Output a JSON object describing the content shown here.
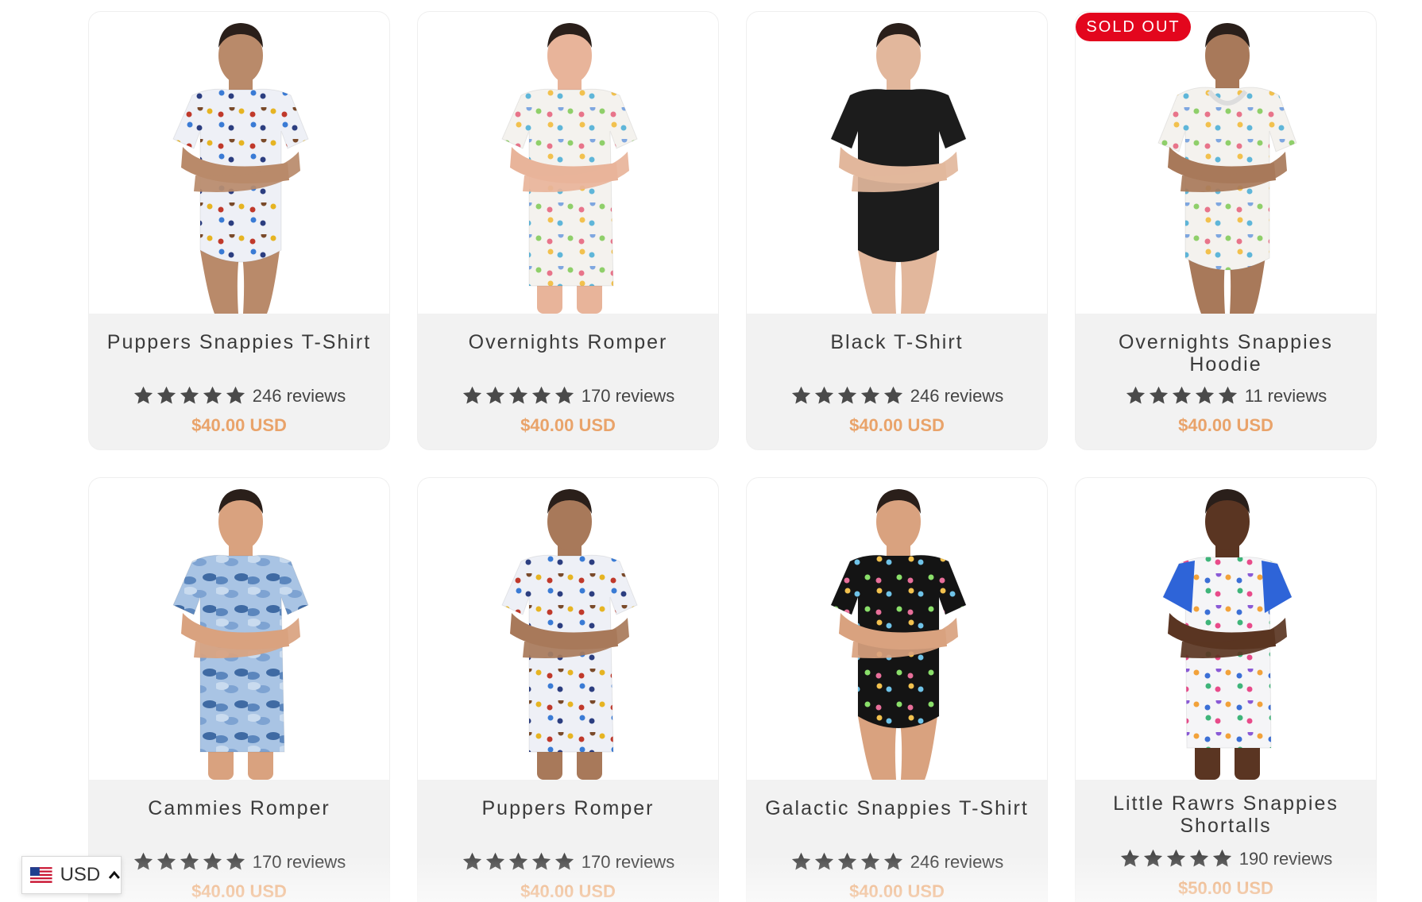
{
  "badge": {
    "sold_out": "SOLD OUT"
  },
  "currency_selector": {
    "code": "USD",
    "flag": "us-flag-icon"
  },
  "colors": {
    "price": "#e9a36a",
    "badge": "#e3061d",
    "card_bg": "#f2f2f2",
    "star": "#4a4a4a"
  },
  "products": [
    {
      "title": "Puppers Snappies T-Shirt",
      "rating_stars": 5,
      "reviews": "246 reviews",
      "price": "$40.00 USD",
      "garment": "tee",
      "pattern": "puppers",
      "skin": "#b98a6a"
    },
    {
      "title": "Overnights Romper",
      "rating_stars": 5,
      "reviews": "170 reviews",
      "price": "$40.00 USD",
      "garment": "romper",
      "pattern": "overnights",
      "skin": "#e8b49a"
    },
    {
      "title": "Black T-Shirt",
      "rating_stars": 5,
      "reviews": "246 reviews",
      "price": "$40.00 USD",
      "garment": "tee",
      "pattern": "black",
      "skin": "#e2b79c"
    },
    {
      "title": "Overnights Snappies Hoodie",
      "rating_stars": 5,
      "reviews": "11 reviews",
      "price": "$40.00 USD",
      "garment": "hoodie",
      "pattern": "overnights",
      "skin": "#a8795a",
      "sold_out": true
    },
    {
      "title": "Cammies Romper",
      "rating_stars": 5,
      "reviews": "170 reviews",
      "price": "$40.00 USD",
      "garment": "romper",
      "pattern": "camo",
      "skin": "#d9a27f"
    },
    {
      "title": "Puppers Romper",
      "rating_stars": 5,
      "reviews": "170 reviews",
      "price": "$40.00 USD",
      "garment": "romper",
      "pattern": "puppers",
      "skin": "#a8795a"
    },
    {
      "title": "Galactic Snappies T-Shirt",
      "rating_stars": 5,
      "reviews": "246 reviews",
      "price": "$40.00 USD",
      "garment": "tee",
      "pattern": "galactic",
      "skin": "#d9a27f"
    },
    {
      "title": "Little Rawrs Snappies Shortalls",
      "rating_stars": 5,
      "reviews": "190 reviews",
      "price": "$50.00 USD",
      "garment": "shortalls",
      "pattern": "rawrs",
      "skin": "#5a3522"
    }
  ]
}
